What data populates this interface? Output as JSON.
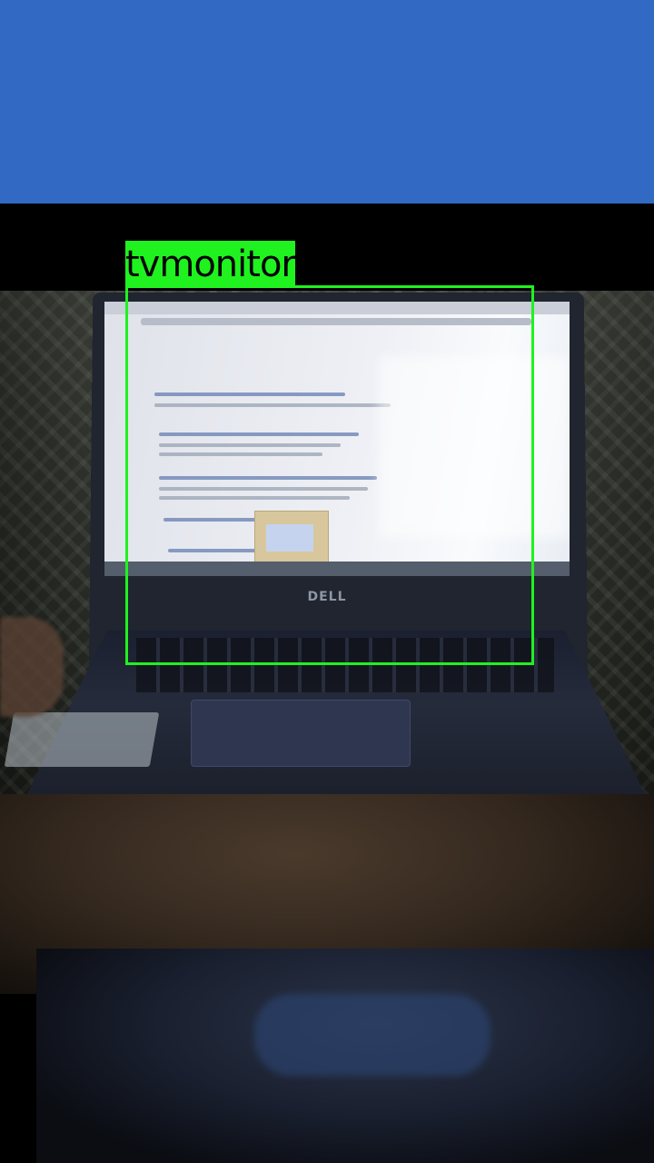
{
  "app_bar": {
    "color": "#3269C2"
  },
  "camera": {
    "scene_brand": "DELL",
    "detections": [
      {
        "label": "tvmonitor",
        "color": "#1FF21F"
      }
    ]
  }
}
